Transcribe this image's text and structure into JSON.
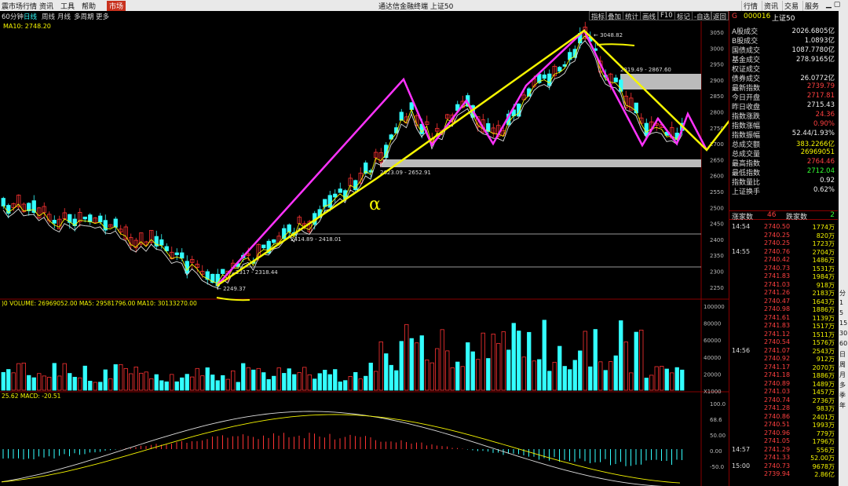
{
  "menu": {
    "app": "震市场行情",
    "items": [
      "资讯",
      "工具",
      "帮助"
    ],
    "active": "市场",
    "window_title": "通达信金融终端 上证50",
    "right_buttons": [
      "行情",
      "资讯",
      "交易",
      "服务"
    ]
  },
  "toolbar": {
    "timeframes": [
      "60分钟",
      "日线",
      "周线",
      "月线",
      "多周期",
      "更多"
    ],
    "active_timeframe": "日线",
    "buttons": [
      "指标",
      "叠加",
      "统计",
      "画线",
      "F10",
      "标记",
      "-自选",
      "返回"
    ]
  },
  "chart": {
    "ma_label": "MA10: 2748.20",
    "volume_label": ")0  VOLUME: 26969052.00  MA5: 29581796.00  MA10: 30133270.00",
    "macd_label": "25.62  MACD: -20.51",
    "annotations": {
      "high": "← 3048.82",
      "low": "← 2249.37",
      "zone_top": "2819.49 - 2867.60",
      "zone_mid": "2623.09 - 2652.91",
      "line1": "2414.89 - 2418.01",
      "line2": "2317 - 2318.44",
      "handwritten": "α"
    },
    "price_ticks": [
      "3050",
      "3000",
      "2950",
      "2900",
      "2850",
      "2800",
      "2750",
      "2700",
      "2650",
      "2600",
      "2550",
      "2500",
      "2450",
      "2400",
      "2350",
      "2300",
      "2250"
    ],
    "volume_ticks": [
      "100000",
      "80000",
      "60000",
      "40000",
      "20000",
      "X1000"
    ],
    "macd_ticks": [
      "100.0",
      "68.6",
      "50.00",
      "0.00",
      "-50.0"
    ],
    "colors": {
      "up": "#ff3333",
      "down": "#33ffff",
      "trend_pink": "#ff33ff",
      "trend_yellow": "#f5f500"
    }
  },
  "panel": {
    "code": "000016",
    "name": "上证50",
    "prefix": "G",
    "stats": [
      {
        "label": "A股成交",
        "value": "2026.6805亿",
        "color": "white"
      },
      {
        "label": "B股成交",
        "value": "1.0893亿",
        "color": "white"
      },
      {
        "label": "国债成交",
        "value": "1087.7780亿",
        "color": "white"
      },
      {
        "label": "基金成交",
        "value": "278.9165亿",
        "color": "white"
      },
      {
        "label": "权证成交",
        "value": "",
        "color": "white"
      },
      {
        "label": "债券成交",
        "value": "26.0772亿",
        "color": "white"
      },
      {
        "label": "最新指数",
        "value": "2739.79",
        "color": "red"
      },
      {
        "label": "今日开盘",
        "value": "2717.81",
        "color": "red"
      },
      {
        "label": "昨日收盘",
        "value": "2715.43",
        "color": "white"
      },
      {
        "label": "指数涨跌",
        "value": "24.36",
        "color": "red"
      },
      {
        "label": "指数涨幅",
        "value": "0.90%",
        "color": "red"
      },
      {
        "label": "指数振幅",
        "value": "52.44/1.93%",
        "color": "white"
      },
      {
        "label": "总成交额",
        "value": "383.2266亿",
        "color": "yellow"
      },
      {
        "label": "总成交量",
        "value": "26969051",
        "color": "yellow"
      },
      {
        "label": "最高指数",
        "value": "2764.46",
        "color": "red"
      },
      {
        "label": "最低指数",
        "value": "2712.04",
        "color": "green"
      },
      {
        "label": "指数量比",
        "value": "0.92",
        "color": "white"
      },
      {
        "label": "上证换手",
        "value": "0.62%",
        "color": "white"
      }
    ],
    "updown": {
      "up_label": "涨家数",
      "up": "46",
      "down_label": "跌家数",
      "down": "2"
    },
    "ticks": [
      {
        "time": "14:54",
        "price": "2740.50",
        "vol": "1774万"
      },
      {
        "time": "",
        "price": "2740.25",
        "vol": "820万"
      },
      {
        "time": "",
        "price": "2740.25",
        "vol": "1723万"
      },
      {
        "time": "14:55",
        "price": "2740.76",
        "vol": "2704万"
      },
      {
        "time": "",
        "price": "2740.42",
        "vol": "1486万"
      },
      {
        "time": "",
        "price": "2740.73",
        "vol": "1531万"
      },
      {
        "time": "",
        "price": "2741.83",
        "vol": "1984万"
      },
      {
        "time": "",
        "price": "2741.03",
        "vol": "918万"
      },
      {
        "time": "",
        "price": "2741.26",
        "vol": "2183万"
      },
      {
        "time": "",
        "price": "2740.47",
        "vol": "1643万"
      },
      {
        "time": "",
        "price": "2740.98",
        "vol": "1886万"
      },
      {
        "time": "",
        "price": "2741.61",
        "vol": "1139万"
      },
      {
        "time": "",
        "price": "2741.83",
        "vol": "1517万"
      },
      {
        "time": "",
        "price": "2741.12",
        "vol": "1511万"
      },
      {
        "time": "",
        "price": "2740.54",
        "vol": "1576万"
      },
      {
        "time": "14:56",
        "price": "2741.07",
        "vol": "2543万"
      },
      {
        "time": "",
        "price": "2740.92",
        "vol": "912万"
      },
      {
        "time": "",
        "price": "2741.17",
        "vol": "2070万"
      },
      {
        "time": "",
        "price": "2741.18",
        "vol": "1886万"
      },
      {
        "time": "",
        "price": "2740.89",
        "vol": "1489万"
      },
      {
        "time": "",
        "price": "2741.03",
        "vol": "1457万"
      },
      {
        "time": "",
        "price": "2740.74",
        "vol": "2736万"
      },
      {
        "time": "",
        "price": "2741.28",
        "vol": "983万"
      },
      {
        "time": "",
        "price": "2740.86",
        "vol": "2401万"
      },
      {
        "time": "",
        "price": "2740.51",
        "vol": "1993万"
      },
      {
        "time": "",
        "price": "2740.96",
        "vol": "779万"
      },
      {
        "time": "",
        "price": "2741.05",
        "vol": "1796万"
      },
      {
        "time": "14:57",
        "price": "2741.29",
        "vol": "556万"
      },
      {
        "time": "",
        "price": "2741.33",
        "vol": "52.00万"
      },
      {
        "time": "15:00",
        "price": "2740.73",
        "vol": "9678万"
      },
      {
        "time": "",
        "price": "2739.94",
        "vol": "2.86亿"
      }
    ]
  },
  "side_strip": [
    "分",
    "1",
    "5",
    "15",
    "30",
    "60",
    "日",
    "周",
    "月",
    "多",
    "季",
    "年"
  ]
}
